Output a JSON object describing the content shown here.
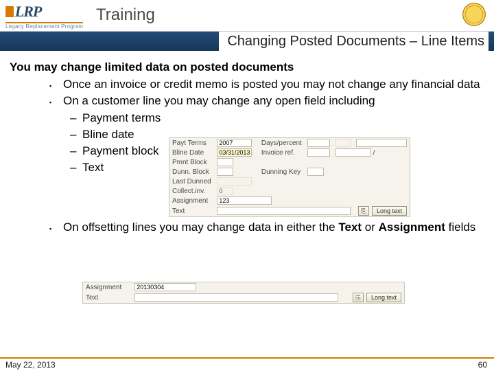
{
  "header": {
    "brand": "LRP",
    "tagline": "Legacy Replacement Program",
    "title": "Training"
  },
  "subtitle": "Changing Posted Documents – Line Items",
  "lead": "You may change limited data on posted documents",
  "bullets": {
    "b1": "Once an invoice or credit memo is posted you may not change any financial data",
    "b2": "On a customer line you may change any open field including",
    "b2_items": {
      "i1": "Payment terms",
      "i2": "Bline date",
      "i3": "Payment block",
      "i4": "Text"
    },
    "b3_pre": "On offsetting lines you may change data in either the ",
    "b3_bold1": "Text",
    "b3_mid": " or ",
    "b3_bold2": "Assignment",
    "b3_post": " fields"
  },
  "sap1": {
    "rows": {
      "payt_terms_lbl": "Payt Terms",
      "payt_terms_val": "2007",
      "days_percent_lbl": "Days/percent",
      "bline_lbl": "Bline Date",
      "bline_val": "03/31/2013",
      "invoice_ref_lbl": "Invoice ref.",
      "pmnt_block_lbl": "Pmnt Block",
      "dunn_block_lbl": "Dunn. Block",
      "dunn_key_lbl": "Dunning Key",
      "last_dunned_lbl": "Last Dunned",
      "collect_lbl": "Collect.inv.",
      "collect_val": "0",
      "assignment_lbl": "Assignment",
      "assignment_val": "123",
      "text_lbl": "Text",
      "long_text_btn": "Long text"
    }
  },
  "sap2": {
    "assignment_lbl": "Assignment",
    "assignment_val": "20130304",
    "text_lbl": "Text",
    "long_text_btn": "Long text"
  },
  "footer": {
    "date": "May 22, 2013",
    "page": "60"
  }
}
